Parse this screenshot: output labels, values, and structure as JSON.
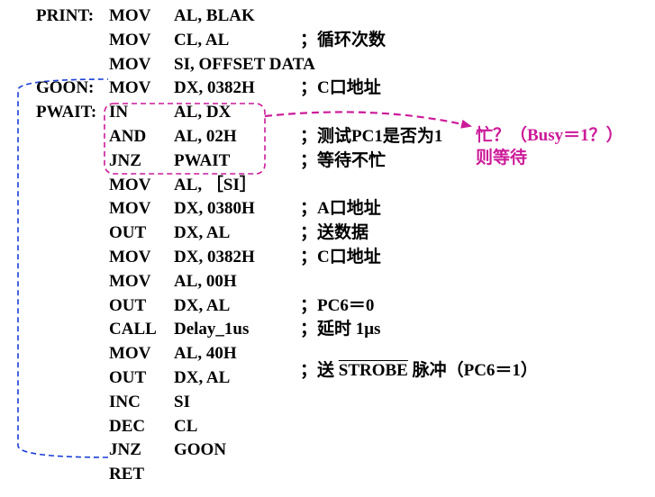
{
  "colors": {
    "text": "#000000",
    "loop_line": "#1a3fd6",
    "busy_annotation": "#cc1a99"
  },
  "lines": [
    {
      "label": "PRINT:",
      "op": "MOV",
      "args": "AL, BLAK",
      "comment": ""
    },
    {
      "label": "",
      "op": "MOV",
      "args": "CL, AL",
      "comment": "；循环次数"
    },
    {
      "label": "",
      "op": "MOV",
      "args": "SI, OFFSET DATA",
      "comment": ""
    },
    {
      "label": "GOON:",
      "op": "MOV",
      "args": "DX, 0382H",
      "comment": "；C口地址"
    },
    {
      "label": "PWAIT:",
      "op": "IN",
      "args": "AL, DX",
      "comment": ""
    },
    {
      "label": "",
      "op": "AND",
      "args": "AL, 02H",
      "comment": "；测试PC1是否为1"
    },
    {
      "label": "",
      "op": "JNZ",
      "args": "PWAIT",
      "comment": "；等待不忙"
    },
    {
      "label": "",
      "op": "MOV",
      "args": "AL, ［SI］",
      "comment": ""
    },
    {
      "label": "",
      "op": "MOV",
      "args": "DX, 0380H",
      "comment": "；A口地址"
    },
    {
      "label": "",
      "op": "OUT",
      "args": "DX, AL",
      "comment": "；送数据"
    },
    {
      "label": "",
      "op": "MOV",
      "args": "DX, 0382H",
      "comment": "；C口地址"
    },
    {
      "label": "",
      "op": "MOV",
      "args": "AL, 00H",
      "comment": ""
    },
    {
      "label": "",
      "op": "OUT",
      "args": "DX, AL",
      "comment": "；PC6＝0"
    },
    {
      "label": "",
      "op": "CALL",
      "args": "Delay_1us",
      "comment": "；延时 1μs"
    },
    {
      "label": "",
      "op": "MOV",
      "args": "AL, 40H",
      "comment": ""
    },
    {
      "label": "",
      "op": "OUT",
      "args": "DX, AL",
      "comment": ""
    },
    {
      "label": "",
      "op": "INC",
      "args": "SI",
      "comment": ""
    },
    {
      "label": "",
      "op": "DEC",
      "args": "CL",
      "comment": ""
    },
    {
      "label": "",
      "op": "JNZ",
      "args": "GOON",
      "comment": ""
    },
    {
      "label": "",
      "op": "RET",
      "args": "",
      "comment": ""
    }
  ],
  "strobe_comment": {
    "prefix": "；送 ",
    "strobe": "STROBE",
    "suffix": " 脉冲（PC6＝1）"
  },
  "busy_note": {
    "line1": "忙？（Busy＝1？）",
    "line2": "则等待"
  }
}
